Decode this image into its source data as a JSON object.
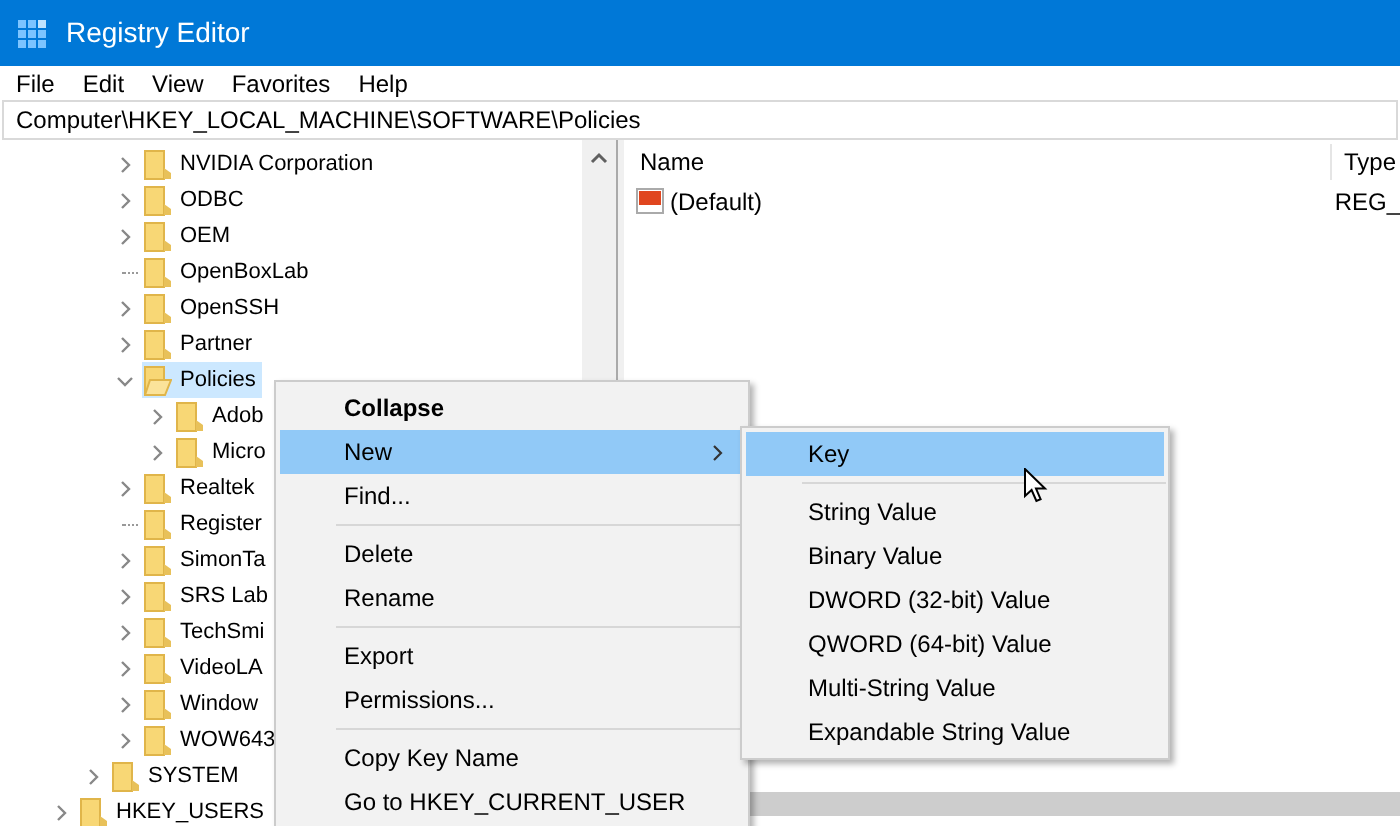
{
  "window": {
    "title": "Registry Editor"
  },
  "menu_bar": [
    "File",
    "Edit",
    "View",
    "Favorites",
    "Help"
  ],
  "address": "Computer\\HKEY_LOCAL_MACHINE\\SOFTWARE\\Policies",
  "tree": {
    "software_keys": [
      {
        "label": "NVIDIA Corporation",
        "expandable": true,
        "expanded": false,
        "selected": false
      },
      {
        "label": "ODBC",
        "expandable": true,
        "expanded": false,
        "selected": false
      },
      {
        "label": "OEM",
        "expandable": true,
        "expanded": false,
        "selected": false
      },
      {
        "label": "OpenBoxLab",
        "expandable": false,
        "expanded": false,
        "selected": false
      },
      {
        "label": "OpenSSH",
        "expandable": true,
        "expanded": false,
        "selected": false
      },
      {
        "label": "Partner",
        "expandable": true,
        "expanded": false,
        "selected": false
      },
      {
        "label": "Policies",
        "expandable": true,
        "expanded": true,
        "selected": true,
        "children": [
          {
            "label": "Adob",
            "expandable": true,
            "expanded": false,
            "selected": false
          },
          {
            "label": "Micro",
            "expandable": true,
            "expanded": false,
            "selected": false
          }
        ]
      },
      {
        "label": "Realtek",
        "expandable": true,
        "expanded": false,
        "selected": false
      },
      {
        "label": "Register",
        "expandable": false,
        "expanded": false,
        "selected": false
      },
      {
        "label": "SimonTa",
        "expandable": true,
        "expanded": false,
        "selected": false
      },
      {
        "label": "SRS Lab",
        "expandable": true,
        "expanded": false,
        "selected": false
      },
      {
        "label": "TechSmi",
        "expandable": true,
        "expanded": false,
        "selected": false
      },
      {
        "label": "VideoLA",
        "expandable": true,
        "expanded": false,
        "selected": false
      },
      {
        "label": "Window",
        "expandable": true,
        "expanded": false,
        "selected": false
      },
      {
        "label": "WOW643",
        "expandable": true,
        "expanded": false,
        "selected": false
      }
    ],
    "machine_keys": [
      {
        "label": "SYSTEM",
        "expandable": true,
        "expanded": false,
        "selected": false
      }
    ],
    "root_keys": [
      {
        "label": "HKEY_USERS",
        "expandable": true,
        "expanded": false,
        "selected": false
      }
    ]
  },
  "values_pane": {
    "columns": [
      "Name",
      "Type"
    ],
    "rows": [
      {
        "name": "(Default)",
        "type": "REG_"
      }
    ]
  },
  "context_menu": {
    "groups": [
      [
        {
          "label": "Collapse",
          "bold": true,
          "selected": false,
          "submenu": false
        },
        {
          "label": "New",
          "bold": false,
          "selected": true,
          "submenu": true
        },
        {
          "label": "Find...",
          "bold": false,
          "selected": false,
          "submenu": false
        }
      ],
      [
        {
          "label": "Delete",
          "bold": false,
          "selected": false,
          "submenu": false
        },
        {
          "label": "Rename",
          "bold": false,
          "selected": false,
          "submenu": false
        }
      ],
      [
        {
          "label": "Export",
          "bold": false,
          "selected": false,
          "submenu": false
        },
        {
          "label": "Permissions...",
          "bold": false,
          "selected": false,
          "submenu": false
        }
      ],
      [
        {
          "label": "Copy Key Name",
          "bold": false,
          "selected": false,
          "submenu": false
        },
        {
          "label": "Go to HKEY_CURRENT_USER",
          "bold": false,
          "selected": false,
          "submenu": false
        }
      ]
    ]
  },
  "submenu": {
    "groups": [
      [
        {
          "label": "Key",
          "selected": true
        }
      ],
      [
        {
          "label": "String Value",
          "selected": false
        },
        {
          "label": "Binary Value",
          "selected": false
        },
        {
          "label": "DWORD (32-bit) Value",
          "selected": false
        },
        {
          "label": "QWORD (64-bit) Value",
          "selected": false
        },
        {
          "label": "Multi-String Value",
          "selected": false
        },
        {
          "label": "Expandable String Value",
          "selected": false
        }
      ]
    ]
  }
}
